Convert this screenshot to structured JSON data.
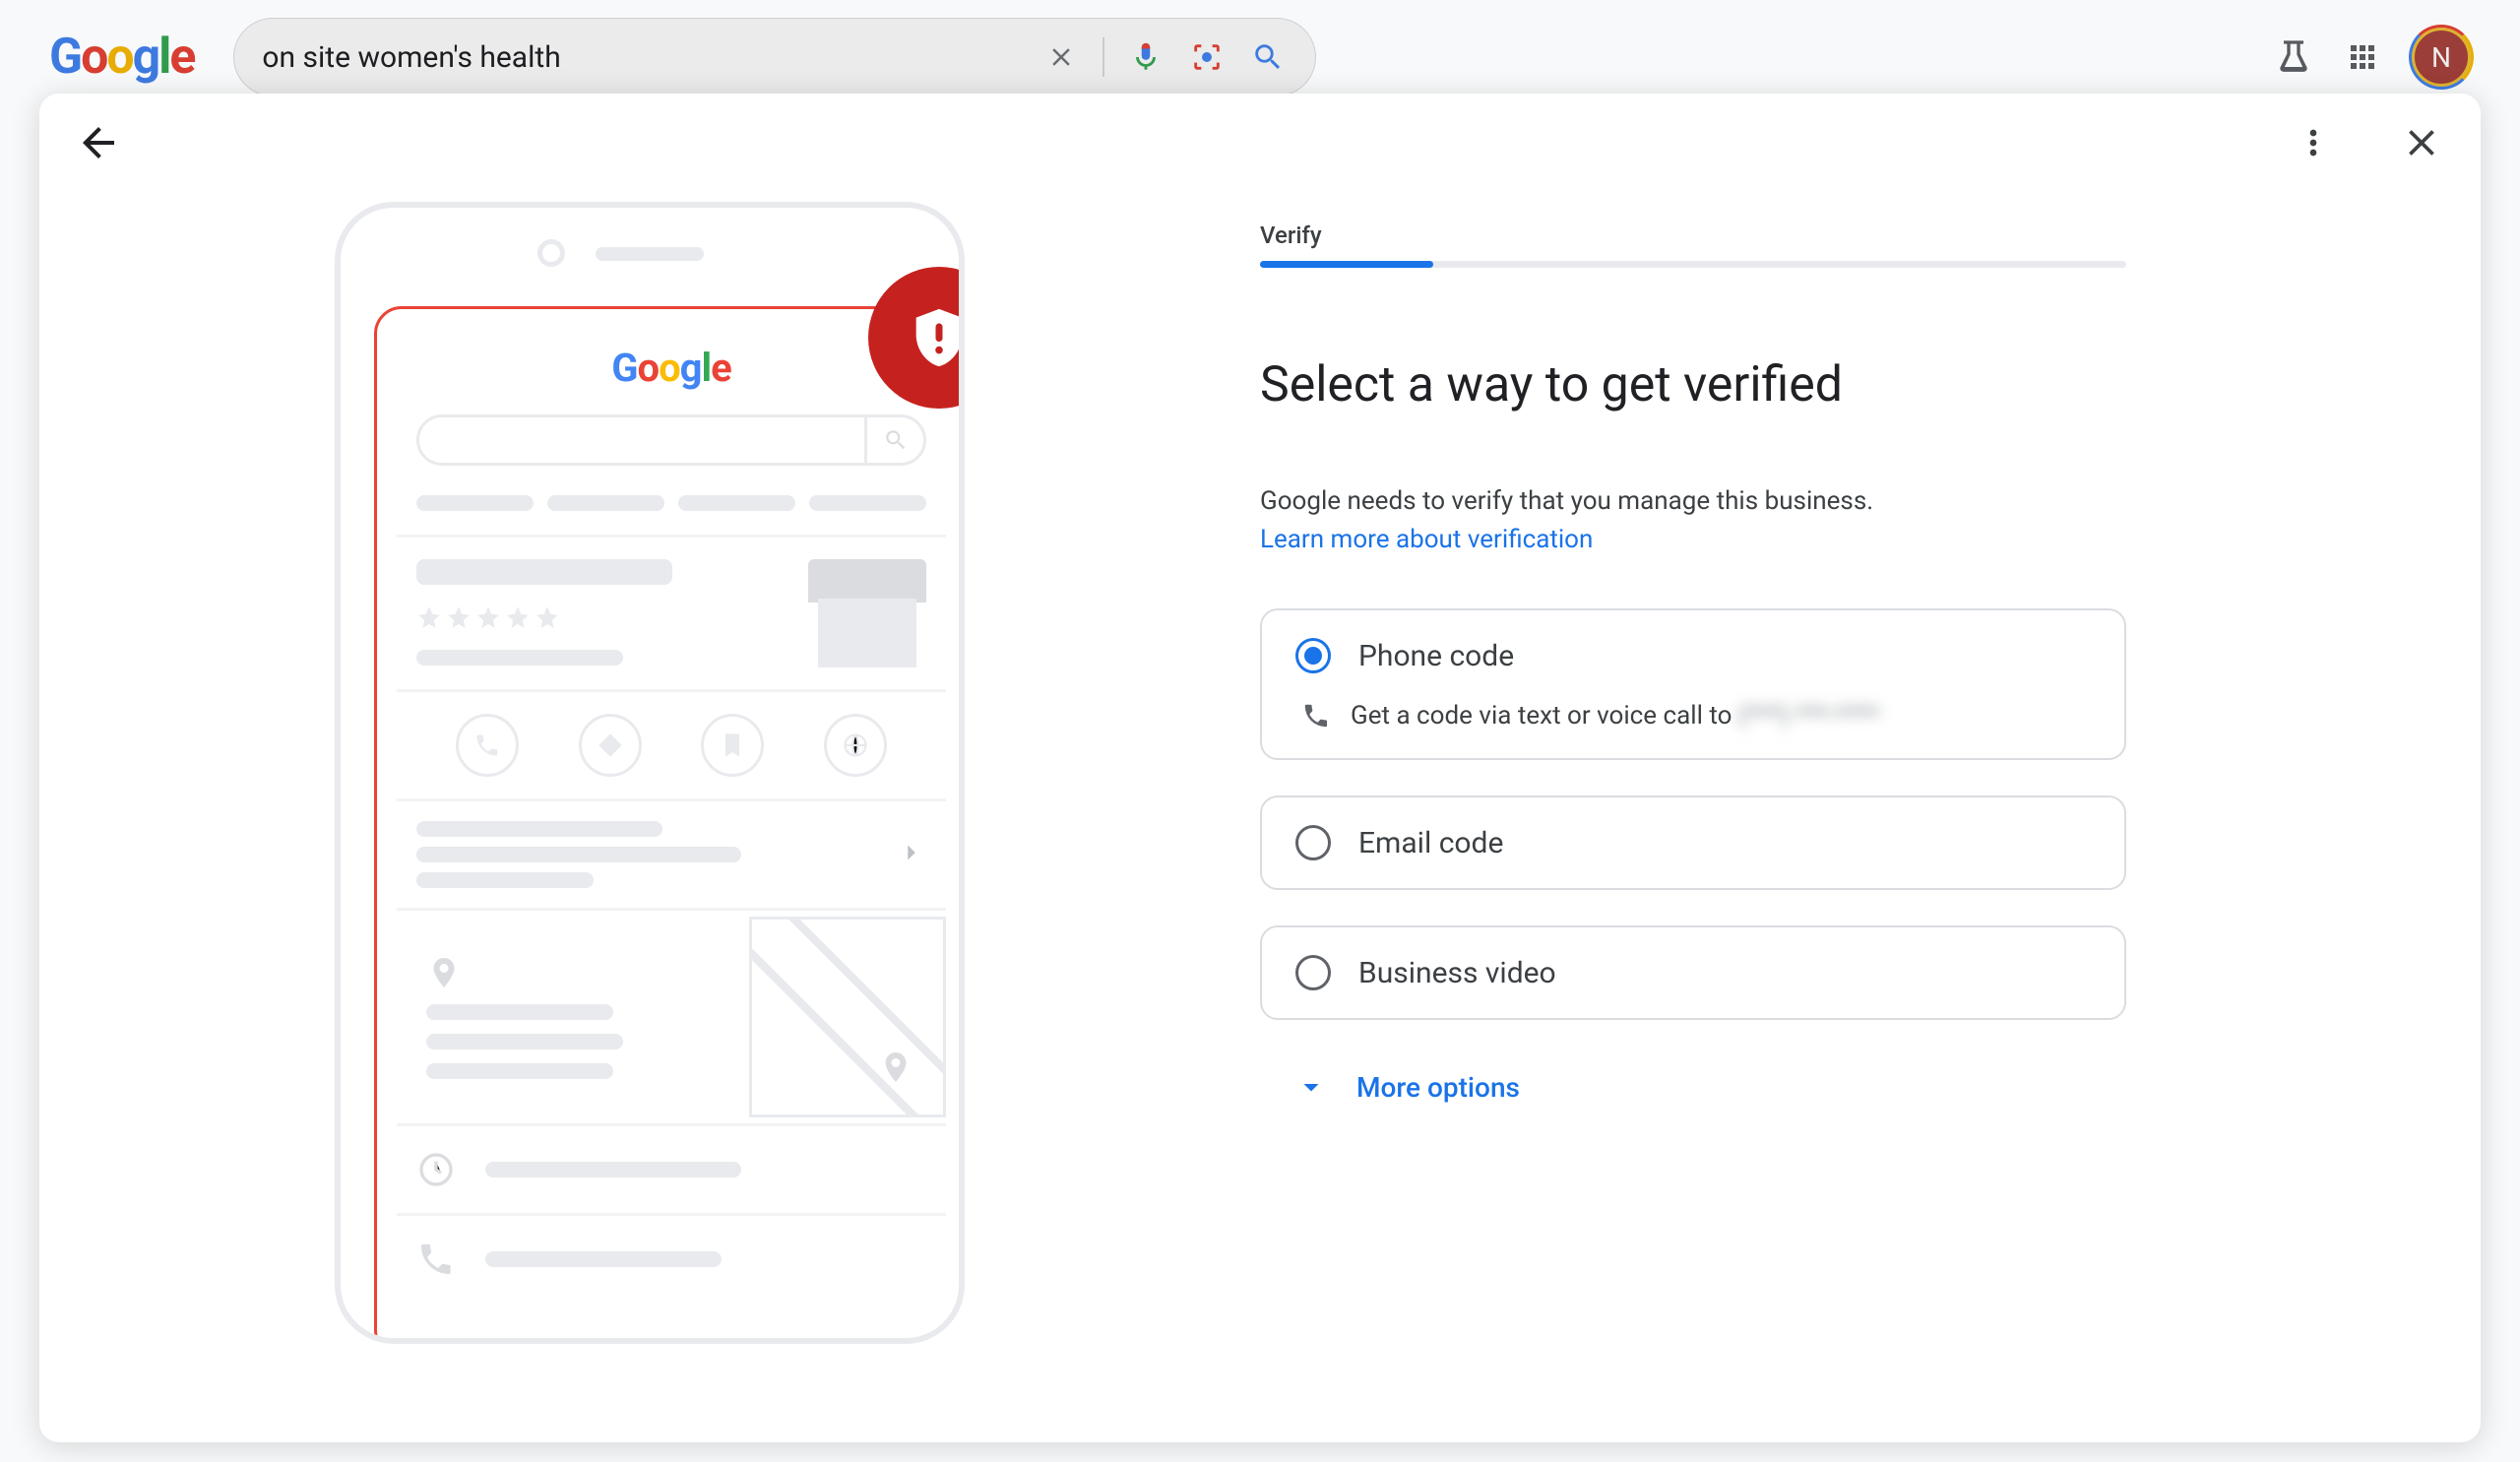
{
  "search": {
    "query": "on site women's health"
  },
  "account": {
    "initial": "N"
  },
  "modal": {
    "step_label": "Verify",
    "progress_percent": 20,
    "heading": "Select a way to get verified",
    "subtext": "Google needs to verify that you manage this business.",
    "learn_more": "Learn more about verification",
    "options": [
      {
        "id": "phone",
        "title": "Phone code",
        "selected": true,
        "desc_prefix": "Get a code via text or voice call to ",
        "desc_masked": "(***) ***-****"
      },
      {
        "id": "email",
        "title": "Email code",
        "selected": false
      },
      {
        "id": "video",
        "title": "Business video",
        "selected": false
      }
    ],
    "more_label": "More options"
  }
}
